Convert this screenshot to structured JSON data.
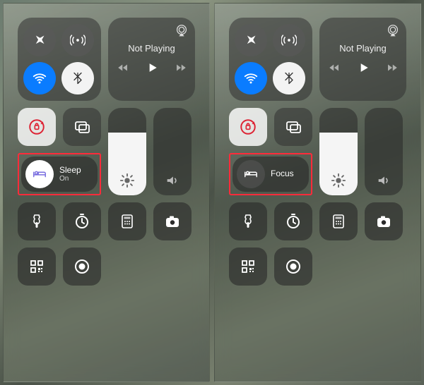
{
  "panels": [
    {
      "media_title": "Not Playing",
      "focus": {
        "label": "Sleep",
        "sub": "On",
        "active": true
      }
    },
    {
      "media_title": "Not Playing",
      "focus": {
        "label": "Focus",
        "sub": "",
        "active": false
      }
    }
  ],
  "icons": {
    "airplane": "airplane-icon",
    "cellular": "cellular-icon",
    "wifi": "wifi-icon",
    "bluetooth": "bluetooth-icon",
    "airplay": "airplay-icon",
    "prev": "prev-track-icon",
    "play": "play-icon",
    "next": "next-track-icon",
    "lock_rotation": "rotation-lock-icon",
    "screen_mirror": "screen-mirroring-icon",
    "bed": "bed-icon",
    "brightness": "brightness-icon",
    "volume": "volume-icon",
    "flashlight": "flashlight-icon",
    "timer": "timer-icon",
    "calculator": "calculator-icon",
    "camera": "camera-icon",
    "qr": "qr-scanner-icon",
    "record": "screen-record-icon"
  },
  "colors": {
    "highlight_border": "#ff2b3a",
    "wifi_bg": "#0a7cff"
  }
}
